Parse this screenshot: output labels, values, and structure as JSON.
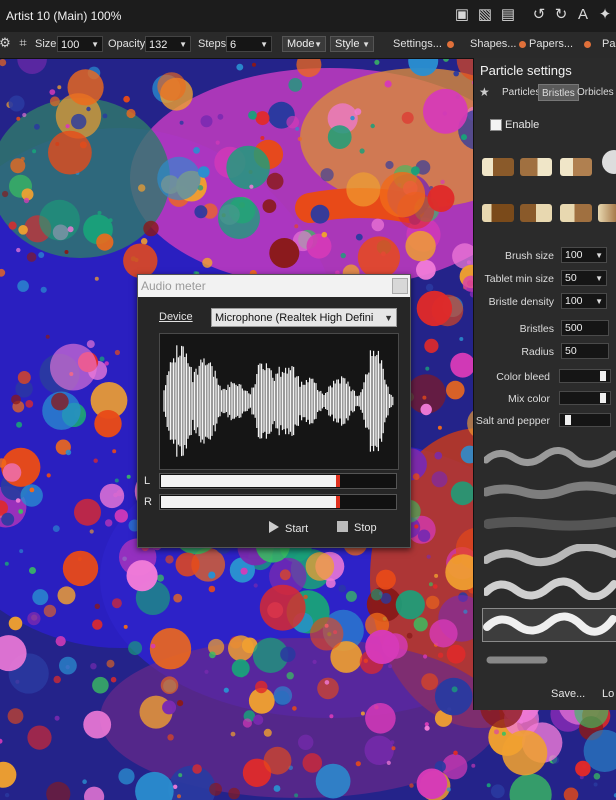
{
  "window": {
    "title": "Artist 10  (Main)   100%"
  },
  "toolbar": {
    "size_label": "Size",
    "size_value": "100",
    "opacity_label": "Opacity",
    "opacity_value": "132",
    "steps_label": "Steps",
    "steps_value": "6",
    "mode_label": "Mode",
    "style_label": "Style",
    "settings_label": "Settings...",
    "shapes_label": "Shapes...",
    "papers_label": "Papers...",
    "pa_label": "Pa"
  },
  "particle_panel": {
    "title": "Particle settings",
    "tabs": [
      {
        "label": "Particles",
        "active": false
      },
      {
        "label": "Bristles",
        "active": true
      },
      {
        "label": "Orbicles",
        "active": false
      }
    ],
    "enable_label": "Enable",
    "enable_checked": false,
    "fields": [
      {
        "label": "Brush size",
        "value": "100"
      },
      {
        "label": "Tablet min size",
        "value": "50"
      },
      {
        "label": "Bristle density",
        "value": "100"
      },
      {
        "label": "Bristles",
        "value": "500"
      },
      {
        "label": "Radius",
        "value": "50"
      }
    ],
    "sliders": [
      {
        "label": "Color bleed",
        "level": 0.95
      },
      {
        "label": "Mix color",
        "level": 0.95
      },
      {
        "label": "Salt and pepper",
        "level": 0.12
      }
    ],
    "save_label": "Save...",
    "load_label": "Lo"
  },
  "audio_meter": {
    "title": "Audio meter",
    "device_label": "Device",
    "device_value": "Microphone (Realtek High Defini",
    "channel_l": "L",
    "channel_r": "R",
    "level_l": 0.75,
    "level_r": 0.75,
    "start_label": "Start",
    "stop_label": "Stop"
  },
  "colors": {
    "panel_bg": "#2b2b2b",
    "canvas_blue": "#2a1fc0",
    "accent_orange": "#e0703a",
    "meter_peak": "#e0301e"
  }
}
